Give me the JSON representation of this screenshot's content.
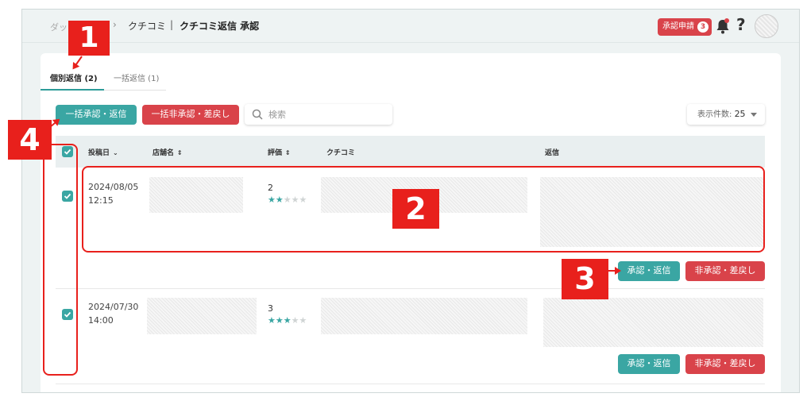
{
  "breadcrumb": {
    "root": "ダッ",
    "separator": "›",
    "middle": "クチコミ",
    "bar": "|",
    "current": "クチコミ返信 承認"
  },
  "header": {
    "request_label": "承認申請",
    "request_count": "3",
    "help": "?"
  },
  "tabs": [
    {
      "label": "個別返信 (2)",
      "active": true
    },
    {
      "label": "一括返信 (1)",
      "active": false
    }
  ],
  "toolbar": {
    "bulk_approve": "一括承認・返信",
    "bulk_reject": "一括非承認・差戻し",
    "search_placeholder": "検索",
    "per_page_label": "表示件数:",
    "per_page_value": "25"
  },
  "columns": {
    "date": "投稿日",
    "store": "店舗名",
    "rating": "評価",
    "review": "クチコミ",
    "reply": "返信"
  },
  "rows": [
    {
      "date": "2024/08/05",
      "time": "12:15",
      "rating": 2,
      "rating_text": "2",
      "approve": "承認・返信",
      "reject": "非承認・差戻し",
      "checked": true
    },
    {
      "date": "2024/07/30",
      "time": "14:00",
      "rating": 3,
      "rating_text": "3",
      "approve": "承認・返信",
      "reject": "非承認・差戻し",
      "checked": true
    }
  ],
  "callouts": [
    "1",
    "2",
    "3",
    "4"
  ],
  "colors": {
    "teal": "#3aa6a3",
    "red": "#d9434a",
    "callout": "#e8201c"
  }
}
